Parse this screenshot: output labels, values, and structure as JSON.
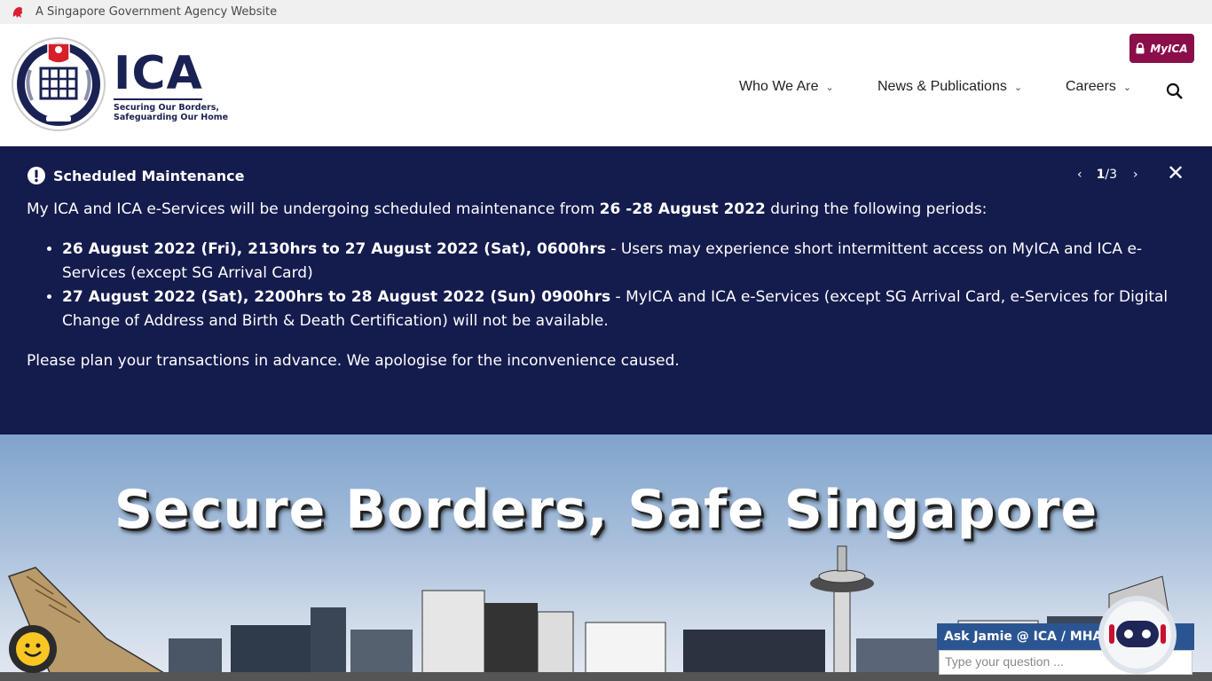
{
  "masthead": {
    "text": "A Singapore Government Agency Website",
    "icon": "lion-head-icon"
  },
  "header": {
    "logo_title": "ICA",
    "logo_tagline_1": "Securing Our Borders,",
    "logo_tagline_2": "Safeguarding Our Home",
    "myica_label": "MyICA",
    "nav": [
      {
        "label": "Who We Are"
      },
      {
        "label": "News & Publications"
      },
      {
        "label": "Careers"
      }
    ]
  },
  "banner": {
    "title": "Scheduled Maintenance",
    "page_current": "1",
    "page_total": "/3",
    "intro_pre": "My ICA and ICA e-Services will be undergoing scheduled maintenance from ",
    "intro_bold": "26 -28 August 2022",
    "intro_post": " during the following periods:",
    "items": [
      {
        "bold": "26 August 2022 (Fri), 2130hrs to 27 August 2022 (Sat), 0600hrs",
        "text": " - Users may experience short intermittent access on MyICA and ICA e-Services (except SG Arrival Card)"
      },
      {
        "bold": "27 August 2022 (Sat), 2200hrs to 28 August 2022 (Sun) 0900hrs",
        "text": " - MyICA and ICA e-Services (except SG Arrival Card, e-Services for Digital Change of Address and Birth & Death Certification) will not be available."
      }
    ],
    "closing": "Please plan your transactions in advance. We apologise for the inconvenience caused."
  },
  "hero": {
    "title": "Secure Borders, Safe Singapore"
  },
  "chat": {
    "header": "Ask Jamie @ ICA / MHA",
    "placeholder": "Type your question ..."
  },
  "colors": {
    "navy": "#141b4d",
    "myica": "#8b0e4a",
    "chat": "#2b5592"
  }
}
